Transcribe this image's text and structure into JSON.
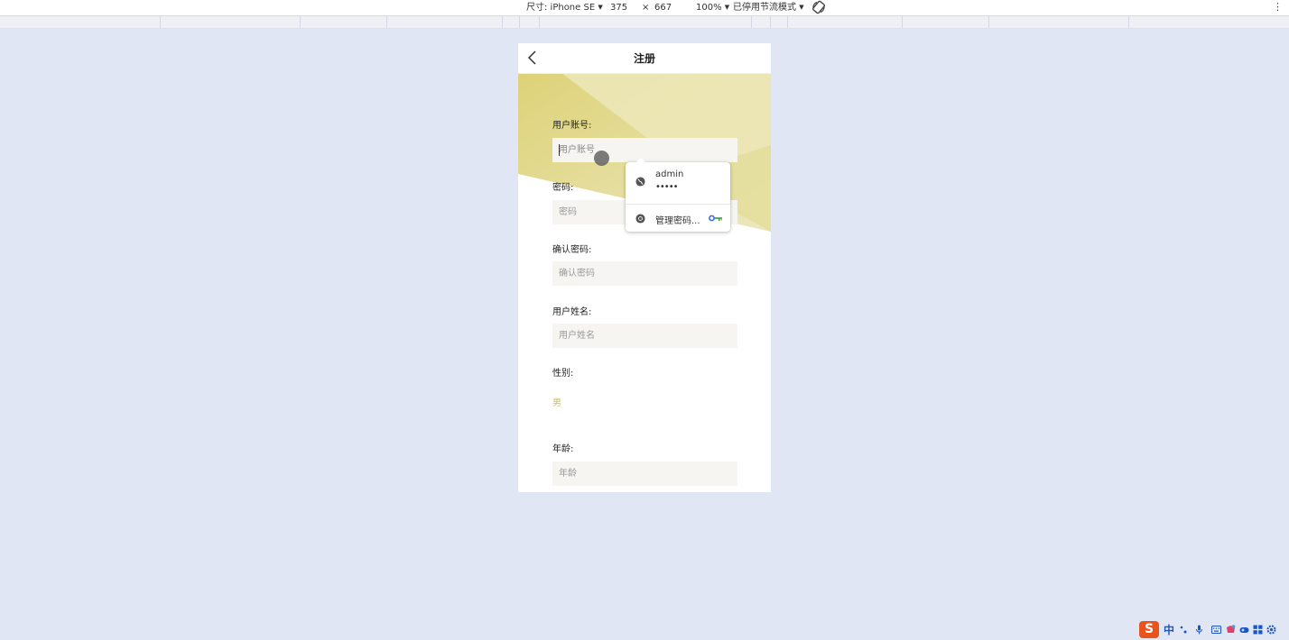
{
  "devtools": {
    "size_label": "尺寸: iPhone SE",
    "width": "375",
    "times": "×",
    "height": "667",
    "zoom": "100%",
    "throttle": "已停用节流模式"
  },
  "page": {
    "title": "注册",
    "fields": {
      "account": {
        "label": "用户账号:",
        "placeholder": "用户账号"
      },
      "password": {
        "label": "密码:",
        "placeholder": "密码"
      },
      "confirm": {
        "label": "确认密码:",
        "placeholder": "确认密码"
      },
      "name": {
        "label": "用户姓名:",
        "placeholder": "用户姓名"
      },
      "gender": {
        "label": "性别:",
        "value": "男"
      },
      "age": {
        "label": "年龄:",
        "placeholder": "年龄"
      }
    }
  },
  "autofill": {
    "username": "admin",
    "password_mask": "•••••",
    "manage_label": "管理密码..."
  },
  "ime": {
    "logo": "S",
    "mode": "中"
  },
  "colors": {
    "hero_yellow": "#e3d98a",
    "gender_accent": "#c9c25a",
    "ime_brand": "#e8541e"
  }
}
